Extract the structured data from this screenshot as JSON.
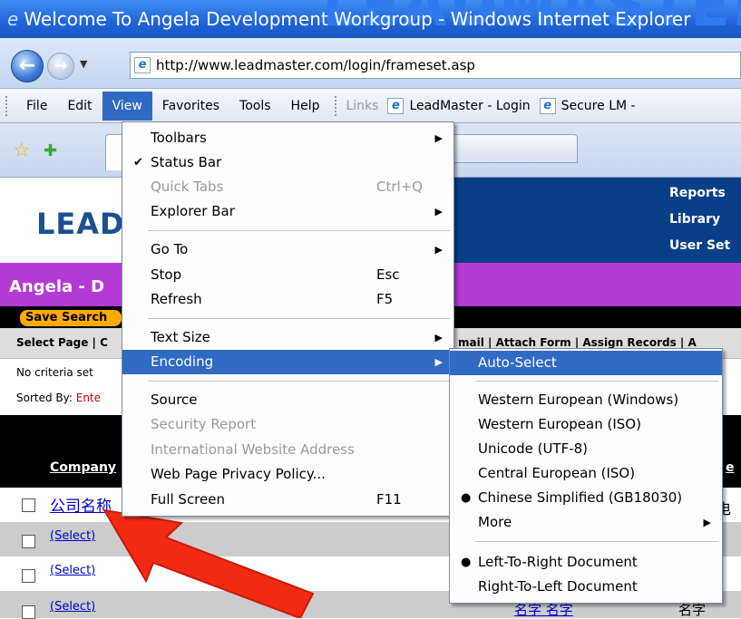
{
  "window": {
    "title": "Welcome To Angela Development Workgroup - Windows Internet Explorer",
    "ie_glyph": "e",
    "watermark": "LEADMASTER"
  },
  "address": {
    "url": "http://www.leadmaster.com/login/frameset.asp",
    "back_glyph": "←",
    "forward_glyph": "→",
    "dropdown_glyph": "▼"
  },
  "menubar": {
    "items": [
      "File",
      "Edit",
      "View",
      "Favorites",
      "Tools",
      "Help"
    ],
    "active": "View",
    "links_label": "Links",
    "favorites_links": [
      "LeadMaster - Login",
      "Secure LM -"
    ]
  },
  "tabs": {
    "favorites_star": "☆",
    "add_favorites": "✚"
  },
  "page": {
    "logo": "LEAD",
    "banner_links": [
      "Reports",
      "Library",
      "User Set"
    ],
    "workgroup_title": "Angela - D",
    "save_search": "Save Search",
    "select_page": "Select Page | C",
    "toolbar_right": "mail | Attach Form | Assign Records | A",
    "criteria": "No criteria set",
    "sorted_by_label": "Sorted By: ",
    "sorted_by_value": "Ente",
    "company_header": "Company",
    "header_tail": "e",
    "rows": [
      {
        "text": "公司名称",
        "tail": "电话"
      },
      {
        "text": "(Select)"
      },
      {
        "text": "(Select)"
      },
      {
        "text": "(Select)",
        "mid": "名字 名字",
        "tail": "名字"
      }
    ]
  },
  "view_menu": {
    "items": [
      {
        "label": "Toolbars",
        "submenu": true
      },
      {
        "label": "Status Bar",
        "checked": true
      },
      {
        "label": "Quick Tabs",
        "shortcut": "Ctrl+Q",
        "disabled": true
      },
      {
        "label": "Explorer Bar",
        "submenu": true
      },
      {
        "label": "Go To",
        "submenu": true
      },
      {
        "label": "Stop",
        "shortcut": "Esc"
      },
      {
        "label": "Refresh",
        "shortcut": "F5"
      },
      {
        "label": "Text Size",
        "submenu": true
      },
      {
        "label": "Encoding",
        "submenu": true,
        "highlighted": true
      },
      {
        "label": "Source"
      },
      {
        "label": "Security Report",
        "disabled": true
      },
      {
        "label": "International Website Address",
        "disabled": true
      },
      {
        "label": "Web Page Privacy Policy..."
      },
      {
        "label": "Full Screen",
        "shortcut": "F11"
      }
    ],
    "check_glyph": "✔",
    "submenu_glyph": "▶"
  },
  "encoding_menu": {
    "items": [
      {
        "label": "Auto-Select",
        "highlighted": true
      },
      {
        "label": "Western European (Windows)"
      },
      {
        "label": "Western European (ISO)"
      },
      {
        "label": "Unicode (UTF-8)"
      },
      {
        "label": "Central European (ISO)"
      },
      {
        "label": "Chinese Simplified (GB18030)",
        "selected": true
      },
      {
        "label": "More",
        "submenu": true
      },
      {
        "label": "Left-To-Right Document",
        "selected": true
      },
      {
        "label": "Right-To-Left Document"
      }
    ],
    "bullet_glyph": "●",
    "submenu_glyph": "▶"
  },
  "colors": {
    "menu_highlight": "#316ac5",
    "banner_blue": "#0a3f88",
    "workgroup_purple": "#b43ad6",
    "save_orange": "#ffaa00",
    "arrow_red": "#f22a12"
  }
}
